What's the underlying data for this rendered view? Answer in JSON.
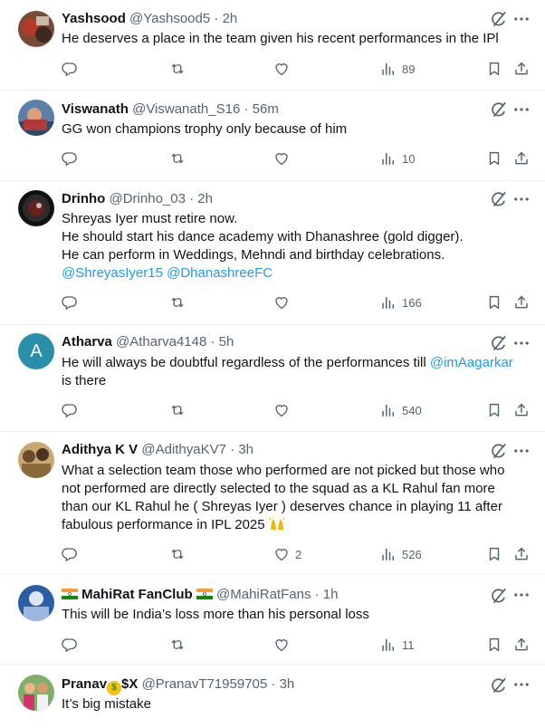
{
  "tweets": [
    {
      "name": "Yashsood",
      "handle": "@Yashsood5",
      "time": "2h",
      "lines": [
        "He deserves a place in the team given his recent performances in the IPl"
      ],
      "stats": {
        "replies": "",
        "reposts": "",
        "likes": "",
        "views": "89"
      }
    },
    {
      "name": "Viswanath",
      "handle": "@Viswanath_S16",
      "time": "56m",
      "lines": [
        "GG won champions trophy only because of him"
      ],
      "stats": {
        "replies": "",
        "reposts": "",
        "likes": "",
        "views": "10"
      }
    },
    {
      "name": "Drinho",
      "handle": "@Drinho_03",
      "time": "2h",
      "lines": [
        "Shreyas Iyer must retire now.",
        "He should start his dance academy with Dhanashree (gold digger).",
        "He can perform in Weddings, Mehndi and birthday celebrations."
      ],
      "mentions": [
        "@ShreyasIyer15",
        "@DhanashreeFC"
      ],
      "stats": {
        "replies": "",
        "reposts": "",
        "likes": "",
        "views": "166"
      }
    },
    {
      "name": "Atharva",
      "handle": "@Atharva4148",
      "time": "5h",
      "avatar_letter": "A",
      "line1": "He will always be doubtful regardless of the performances till",
      "mention": "@imAagarkar",
      "line2": "is there",
      "stats": {
        "replies": "",
        "reposts": "",
        "likes": "",
        "views": "540"
      }
    },
    {
      "name": "Adithya K V",
      "handle": "@AdithyaKV7",
      "time": "3h",
      "lines": [
        "What a selection team those who performed are not picked but those who",
        "not performed are directly selected to the squad as a KL Rahul fan more",
        "than our KL Rahul he ( Shreyas Iyer ) deserves chance in playing 11 after",
        "fabulous performance in IPL 2025"
      ],
      "stats": {
        "replies": "",
        "reposts": "",
        "likes": "2",
        "views": "526"
      }
    },
    {
      "name": "MahiRat FanClub",
      "handle": "@MahiRatFans",
      "time": "1h",
      "lines": [
        "This will be India’s loss more than his personal loss"
      ],
      "stats": {
        "replies": "",
        "reposts": "",
        "likes": "",
        "views": "11"
      }
    },
    {
      "name_prefix": "Pranav",
      "name_suffix": "$X",
      "handle": "@PranavT71959705",
      "time": "3h",
      "lines": [
        "It’s big mistake"
      ]
    }
  ],
  "separator": "·",
  "colors": {
    "text": "#0f1419",
    "secondary": "#536471",
    "link": "#1d9bf0",
    "border": "#eff3f4",
    "atharva_avatar": "#2a8fa8"
  },
  "icons": [
    "grok-icon",
    "more-icon",
    "reply-icon",
    "repost-icon",
    "like-icon",
    "views-icon",
    "bookmark-icon",
    "share-icon"
  ]
}
